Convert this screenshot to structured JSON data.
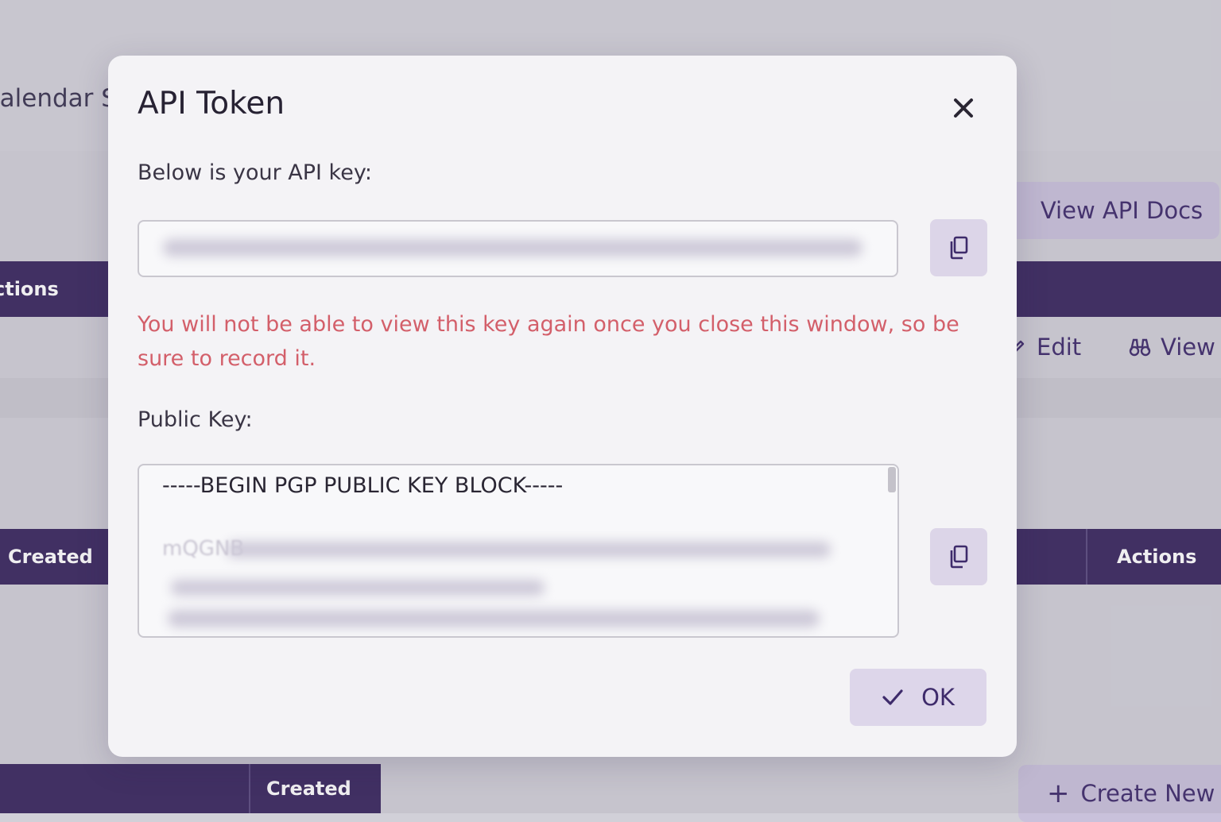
{
  "background": {
    "page_title": "Calendar Se",
    "view_api_docs_label": "View API Docs",
    "table1_actions_header": "ctions",
    "edit_label": "Edit",
    "view_label": "View",
    "table2_created_header": "Created",
    "table2_actions_header": "Actions",
    "table3_created_header": "Created",
    "create_new_label": "Create New S"
  },
  "modal": {
    "title": "API Token",
    "api_key_label": "Below is your API key:",
    "warning": "You will not be able to view this key again once you close this window, so be sure to record it.",
    "public_key_label": "Public Key:",
    "public_key_begin": "-----BEGIN PGP PUBLIC KEY BLOCK-----",
    "public_key_start": "mQGNB",
    "ok_label": "OK"
  },
  "colors": {
    "accent": "#3a275f",
    "warning": "#d35f6a",
    "button_bg": "#ddd6ea"
  },
  "icons": {
    "close": "close-icon",
    "copy": "copy-icon",
    "ok": "check-icon",
    "edit": "pencil-icon",
    "view": "binoculars-icon",
    "create": "plus-icon"
  }
}
